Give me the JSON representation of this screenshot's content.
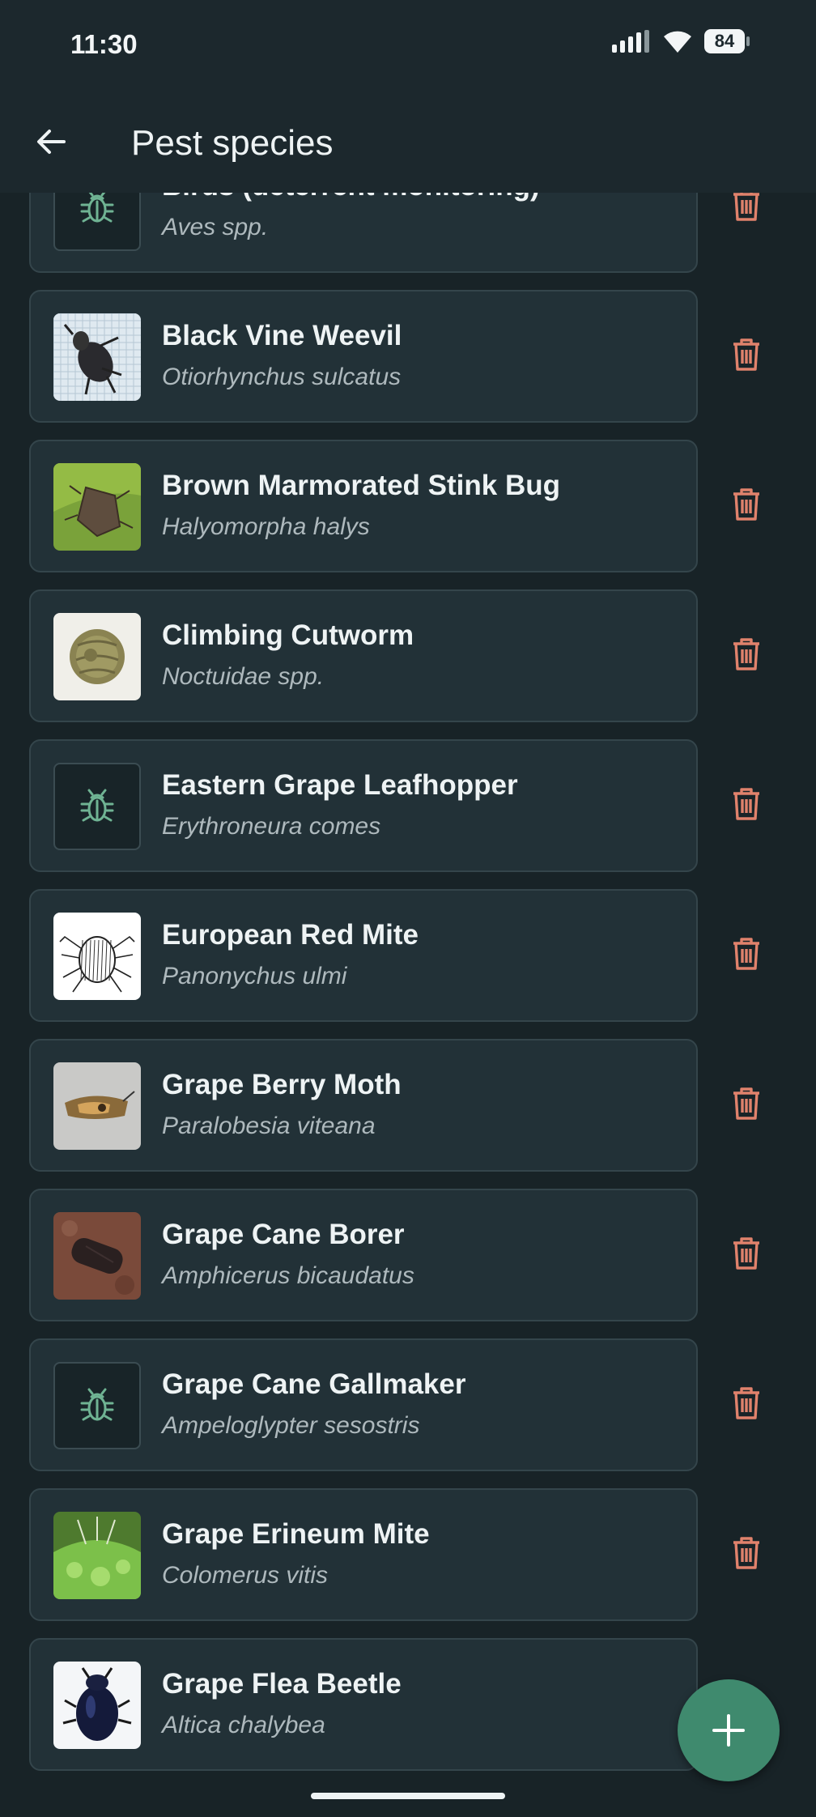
{
  "status_bar": {
    "time": "11:30",
    "battery": "84",
    "icons": [
      "signal-icon",
      "wifi-icon",
      "battery-icon"
    ]
  },
  "app_bar": {
    "title": "Pest species",
    "back_icon": "arrow-left-icon"
  },
  "colors": {
    "background": "#182327",
    "card": "#223137",
    "card_border": "#34454b",
    "delete_accent": "#e0826c",
    "fab": "#3f8a6e",
    "bug_icon": "#6fb393"
  },
  "pests": [
    {
      "common_name": "Birds (deterrent monitoring)",
      "scientific_name": "Aves spp.",
      "thumb": "bug-placeholder"
    },
    {
      "common_name": "Black Vine Weevil",
      "scientific_name": "Otiorhynchus sulcatus",
      "thumb": "weevil-photo"
    },
    {
      "common_name": "Brown Marmorated Stink Bug",
      "scientific_name": "Halyomorpha halys",
      "thumb": "stinkbug-photo"
    },
    {
      "common_name": "Climbing Cutworm",
      "scientific_name": "Noctuidae spp.",
      "thumb": "cutworm-photo"
    },
    {
      "common_name": "Eastern Grape Leafhopper",
      "scientific_name": "Erythroneura comes",
      "thumb": "bug-placeholder"
    },
    {
      "common_name": "European Red Mite",
      "scientific_name": "Panonychus ulmi",
      "thumb": "mite-drawing"
    },
    {
      "common_name": "Grape Berry Moth",
      "scientific_name": "Paralobesia viteana",
      "thumb": "moth-photo"
    },
    {
      "common_name": "Grape Cane Borer",
      "scientific_name": "Amphicerus bicaudatus",
      "thumb": "borer-photo"
    },
    {
      "common_name": "Grape Cane Gallmaker",
      "scientific_name": "Ampeloglypter sesostris",
      "thumb": "bug-placeholder"
    },
    {
      "common_name": "Grape Erineum Mite",
      "scientific_name": "Colomerus vitis",
      "thumb": "leaf-photo"
    },
    {
      "common_name": "Grape Flea Beetle",
      "scientific_name": "Altica chalybea",
      "thumb": "beetle-photo"
    }
  ],
  "fab": {
    "icon": "plus-icon"
  }
}
